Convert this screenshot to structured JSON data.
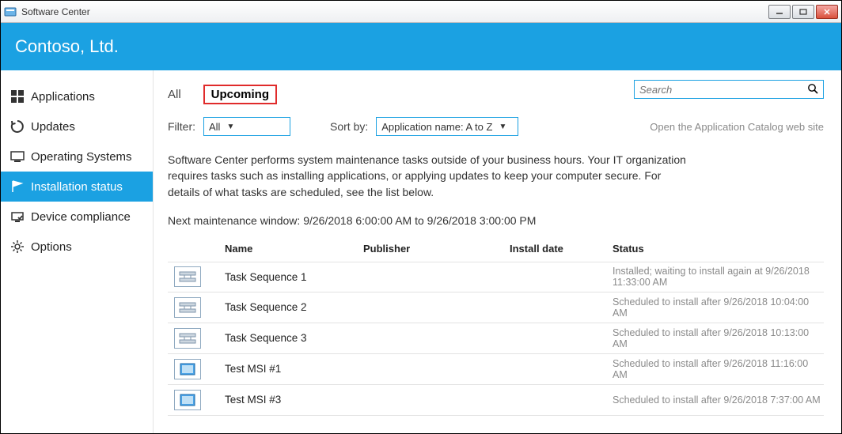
{
  "window": {
    "title": "Software Center"
  },
  "banner": {
    "company": "Contoso, Ltd."
  },
  "sidebar": {
    "items": [
      {
        "label": "Applications",
        "icon": "apps"
      },
      {
        "label": "Updates",
        "icon": "updates"
      },
      {
        "label": "Operating Systems",
        "icon": "os"
      },
      {
        "label": "Installation status",
        "icon": "flag",
        "active": true
      },
      {
        "label": "Device compliance",
        "icon": "compliance"
      },
      {
        "label": "Options",
        "icon": "gear"
      }
    ]
  },
  "tabs": {
    "all": "All",
    "upcoming": "Upcoming"
  },
  "search": {
    "placeholder": "Search"
  },
  "filter": {
    "label": "Filter:",
    "value": "All",
    "sort_label": "Sort by:",
    "sort_value": "Application name: A to Z"
  },
  "catalog_link": "Open the Application Catalog web site",
  "description": "Software Center performs system maintenance tasks outside of your business hours. Your IT organization requires tasks such as installing applications, or applying updates to keep your computer secure. For details of what tasks are scheduled, see the list below.",
  "maintenance": "Next maintenance window: 9/26/2018 6:00:00 AM to 9/26/2018 3:00:00 PM",
  "columns": {
    "name": "Name",
    "publisher": "Publisher",
    "install_date": "Install date",
    "status": "Status"
  },
  "rows": [
    {
      "icon": "task",
      "name": "Task Sequence 1",
      "publisher": "",
      "install_date": "",
      "status": "Installed; waiting to install again at 9/26/2018 11:33:00 AM"
    },
    {
      "icon": "task",
      "name": "Task Sequence 2",
      "publisher": "",
      "install_date": "",
      "status": "Scheduled to install after 9/26/2018 10:04:00 AM"
    },
    {
      "icon": "task",
      "name": "Task Sequence 3",
      "publisher": "",
      "install_date": "",
      "status": "Scheduled to install after 9/26/2018 10:13:00 AM"
    },
    {
      "icon": "msi",
      "name": "Test MSI #1",
      "publisher": "",
      "install_date": "",
      "status": "Scheduled to install after 9/26/2018 11:16:00 AM"
    },
    {
      "icon": "msi",
      "name": "Test MSI #3",
      "publisher": "",
      "install_date": "",
      "status": "Scheduled to install after 9/26/2018 7:37:00 AM"
    }
  ]
}
